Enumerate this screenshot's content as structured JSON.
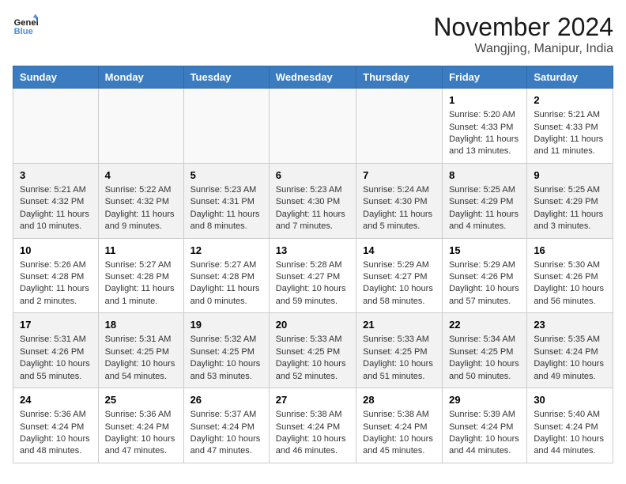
{
  "logo": {
    "line1": "General",
    "line2": "Blue"
  },
  "title": "November 2024",
  "location": "Wangjing, Manipur, India",
  "weekdays": [
    "Sunday",
    "Monday",
    "Tuesday",
    "Wednesday",
    "Thursday",
    "Friday",
    "Saturday"
  ],
  "weeks": [
    [
      {
        "day": "",
        "content": ""
      },
      {
        "day": "",
        "content": ""
      },
      {
        "day": "",
        "content": ""
      },
      {
        "day": "",
        "content": ""
      },
      {
        "day": "",
        "content": ""
      },
      {
        "day": "1",
        "content": "Sunrise: 5:20 AM\nSunset: 4:33 PM\nDaylight: 11 hours and 13 minutes."
      },
      {
        "day": "2",
        "content": "Sunrise: 5:21 AM\nSunset: 4:33 PM\nDaylight: 11 hours and 11 minutes."
      }
    ],
    [
      {
        "day": "3",
        "content": "Sunrise: 5:21 AM\nSunset: 4:32 PM\nDaylight: 11 hours and 10 minutes."
      },
      {
        "day": "4",
        "content": "Sunrise: 5:22 AM\nSunset: 4:32 PM\nDaylight: 11 hours and 9 minutes."
      },
      {
        "day": "5",
        "content": "Sunrise: 5:23 AM\nSunset: 4:31 PM\nDaylight: 11 hours and 8 minutes."
      },
      {
        "day": "6",
        "content": "Sunrise: 5:23 AM\nSunset: 4:30 PM\nDaylight: 11 hours and 7 minutes."
      },
      {
        "day": "7",
        "content": "Sunrise: 5:24 AM\nSunset: 4:30 PM\nDaylight: 11 hours and 5 minutes."
      },
      {
        "day": "8",
        "content": "Sunrise: 5:25 AM\nSunset: 4:29 PM\nDaylight: 11 hours and 4 minutes."
      },
      {
        "day": "9",
        "content": "Sunrise: 5:25 AM\nSunset: 4:29 PM\nDaylight: 11 hours and 3 minutes."
      }
    ],
    [
      {
        "day": "10",
        "content": "Sunrise: 5:26 AM\nSunset: 4:28 PM\nDaylight: 11 hours and 2 minutes."
      },
      {
        "day": "11",
        "content": "Sunrise: 5:27 AM\nSunset: 4:28 PM\nDaylight: 11 hours and 1 minute."
      },
      {
        "day": "12",
        "content": "Sunrise: 5:27 AM\nSunset: 4:28 PM\nDaylight: 11 hours and 0 minutes."
      },
      {
        "day": "13",
        "content": "Sunrise: 5:28 AM\nSunset: 4:27 PM\nDaylight: 10 hours and 59 minutes."
      },
      {
        "day": "14",
        "content": "Sunrise: 5:29 AM\nSunset: 4:27 PM\nDaylight: 10 hours and 58 minutes."
      },
      {
        "day": "15",
        "content": "Sunrise: 5:29 AM\nSunset: 4:26 PM\nDaylight: 10 hours and 57 minutes."
      },
      {
        "day": "16",
        "content": "Sunrise: 5:30 AM\nSunset: 4:26 PM\nDaylight: 10 hours and 56 minutes."
      }
    ],
    [
      {
        "day": "17",
        "content": "Sunrise: 5:31 AM\nSunset: 4:26 PM\nDaylight: 10 hours and 55 minutes."
      },
      {
        "day": "18",
        "content": "Sunrise: 5:31 AM\nSunset: 4:25 PM\nDaylight: 10 hours and 54 minutes."
      },
      {
        "day": "19",
        "content": "Sunrise: 5:32 AM\nSunset: 4:25 PM\nDaylight: 10 hours and 53 minutes."
      },
      {
        "day": "20",
        "content": "Sunrise: 5:33 AM\nSunset: 4:25 PM\nDaylight: 10 hours and 52 minutes."
      },
      {
        "day": "21",
        "content": "Sunrise: 5:33 AM\nSunset: 4:25 PM\nDaylight: 10 hours and 51 minutes."
      },
      {
        "day": "22",
        "content": "Sunrise: 5:34 AM\nSunset: 4:25 PM\nDaylight: 10 hours and 50 minutes."
      },
      {
        "day": "23",
        "content": "Sunrise: 5:35 AM\nSunset: 4:24 PM\nDaylight: 10 hours and 49 minutes."
      }
    ],
    [
      {
        "day": "24",
        "content": "Sunrise: 5:36 AM\nSunset: 4:24 PM\nDaylight: 10 hours and 48 minutes."
      },
      {
        "day": "25",
        "content": "Sunrise: 5:36 AM\nSunset: 4:24 PM\nDaylight: 10 hours and 47 minutes."
      },
      {
        "day": "26",
        "content": "Sunrise: 5:37 AM\nSunset: 4:24 PM\nDaylight: 10 hours and 47 minutes."
      },
      {
        "day": "27",
        "content": "Sunrise: 5:38 AM\nSunset: 4:24 PM\nDaylight: 10 hours and 46 minutes."
      },
      {
        "day": "28",
        "content": "Sunrise: 5:38 AM\nSunset: 4:24 PM\nDaylight: 10 hours and 45 minutes."
      },
      {
        "day": "29",
        "content": "Sunrise: 5:39 AM\nSunset: 4:24 PM\nDaylight: 10 hours and 44 minutes."
      },
      {
        "day": "30",
        "content": "Sunrise: 5:40 AM\nSunset: 4:24 PM\nDaylight: 10 hours and 44 minutes."
      }
    ]
  ]
}
